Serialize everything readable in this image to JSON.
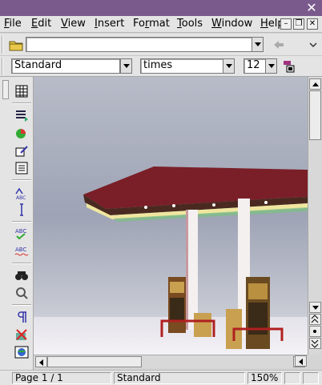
{
  "window": {
    "close_glyph": "✕"
  },
  "menu": {
    "items": [
      {
        "label": "File",
        "u": "F",
        "rest": "ile"
      },
      {
        "label": "Edit",
        "u": "E",
        "rest": "dit"
      },
      {
        "label": "View",
        "u": "V",
        "rest": "iew"
      },
      {
        "label": "Insert",
        "u": "I",
        "rest": "nsert"
      },
      {
        "label": "Format",
        "u": "F",
        "prefix": "Fo",
        "u2": "r",
        "rest": "mat"
      },
      {
        "label": "Tools",
        "u": "T",
        "rest": "ools"
      },
      {
        "label": "Window",
        "u": "W",
        "rest": "indow"
      },
      {
        "label": "Help",
        "u": "H",
        "rest": "elp"
      }
    ]
  },
  "url_bar": {
    "value": ""
  },
  "format_bar": {
    "style": "Standard",
    "font": "times",
    "size": "12"
  },
  "status_bar": {
    "page": "Page 1 / 1",
    "style": "Standard",
    "zoom": "150%"
  },
  "colors": {
    "title_bar": "#7a5a8c",
    "canopy": "#7a1f28",
    "sky": "#9ea3b5"
  }
}
